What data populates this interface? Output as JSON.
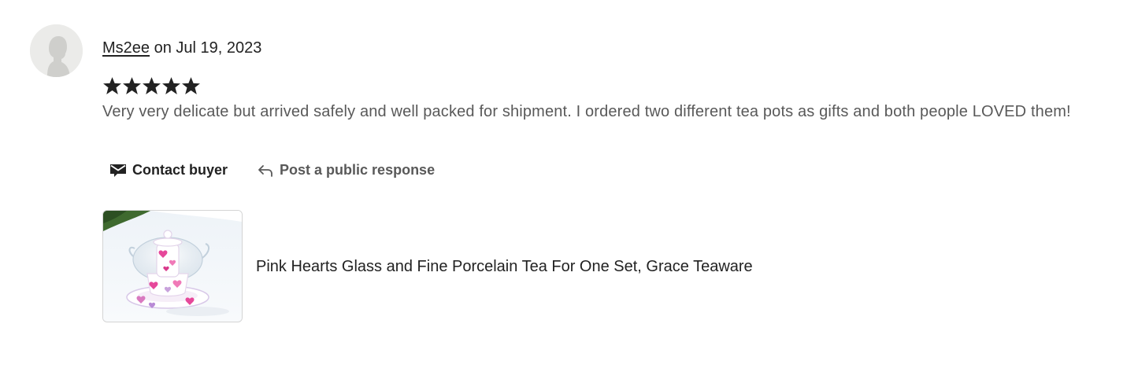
{
  "review": {
    "reviewer": "Ms2ee",
    "date_text": "on Jul 19, 2023",
    "rating": 5,
    "max_rating": 5,
    "text": "Very very delicate but arrived safely and well packed for shipment. I ordered two different tea pots as gifts and both people LOVED them!"
  },
  "actions": {
    "contact_label": "Contact buyer",
    "respond_label": "Post a public response"
  },
  "product": {
    "title": "Pink Hearts Glass and Fine Porcelain Tea For One Set, Grace Teaware"
  },
  "icons": {
    "avatar": "default-user-avatar-icon",
    "star": "star-icon",
    "contact": "mail-icon",
    "respond": "reply-arrow-icon"
  },
  "colors": {
    "text_primary": "#222222",
    "text_secondary": "#595959",
    "star": "#222222",
    "avatar_bg": "#ebebe9"
  }
}
